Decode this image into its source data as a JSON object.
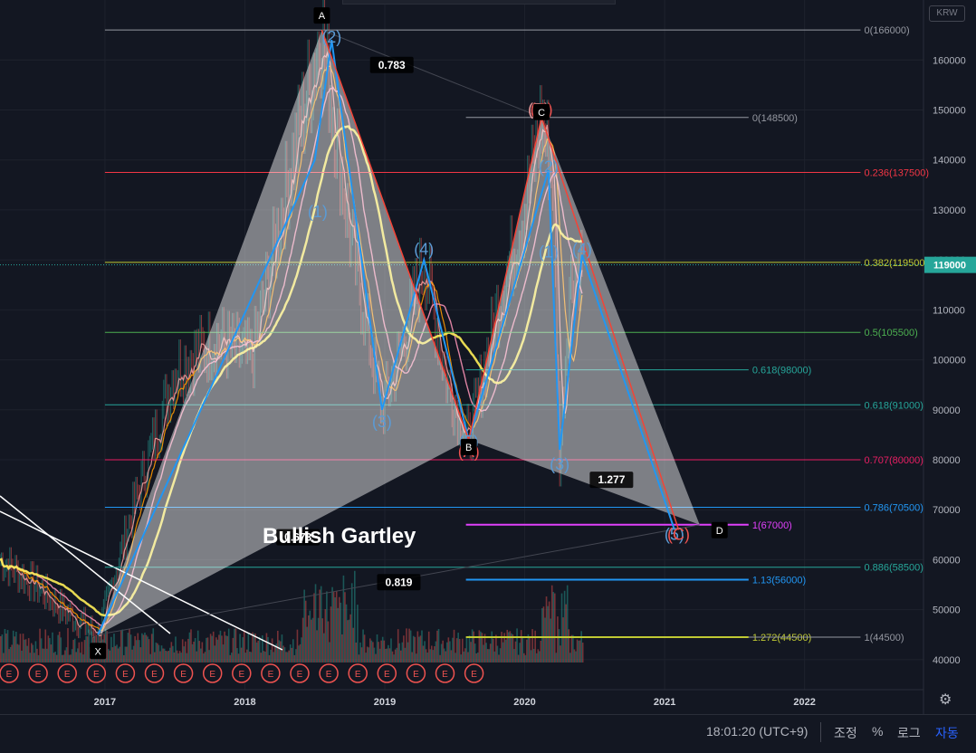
{
  "header": {
    "currency": "KRW"
  },
  "footer": {
    "time": "18:01:20 (UTC+9)",
    "adjust": "조정",
    "percent": "%",
    "log": "로그",
    "auto": "자동"
  },
  "chart_data": {
    "type": "line",
    "title": "Bullish Gartley",
    "price_axis": {
      "min": 34000,
      "max": 172000,
      "ticks": [
        40000,
        50000,
        60000,
        70000,
        80000,
        90000,
        100000,
        110000,
        120000,
        130000,
        140000,
        150000,
        160000
      ]
    },
    "time_axis": {
      "start": 2016.25,
      "end": 2022.85,
      "ticks": [
        {
          "label": "2017",
          "t": 2017.0
        },
        {
          "label": "2018",
          "t": 2018.0
        },
        {
          "label": "2019",
          "t": 2019.0
        },
        {
          "label": "2020",
          "t": 2020.0
        },
        {
          "label": "2021",
          "t": 2021.0
        },
        {
          "label": "2022",
          "t": 2022.0
        }
      ]
    },
    "current_price": {
      "value": 119000,
      "label": "119000"
    },
    "fib_levels": [
      {
        "label": "0(166000)",
        "price": 166000,
        "x1": 2017.0,
        "x2": 2022.4,
        "color": "#9598a1"
      },
      {
        "label": "0(148500)",
        "price": 148500,
        "x1": 2019.58,
        "x2": 2021.6,
        "color": "#9598a1"
      },
      {
        "label": "0.236(137500)",
        "price": 137500,
        "x1": 2017.0,
        "x2": 2022.4,
        "color": "#f23645"
      },
      {
        "label": "0.382(119500)",
        "price": 119500,
        "x1": 2017.0,
        "x2": 2022.4,
        "color": "#c0ca33"
      },
      {
        "label": "0.5(105500)",
        "price": 105500,
        "x1": 2017.0,
        "x2": 2022.4,
        "color": "#4caf50"
      },
      {
        "label": "0.618(98000)",
        "price": 98000,
        "x1": 2019.58,
        "x2": 2021.6,
        "color": "#26a69a"
      },
      {
        "label": "0.618(91000)",
        "price": 91000,
        "x1": 2017.0,
        "x2": 2022.4,
        "color": "#26a69a"
      },
      {
        "label": "0.707(80000)",
        "price": 80000,
        "x1": 2017.0,
        "x2": 2022.4,
        "color": "#e91e63"
      },
      {
        "label": "0.786(70500)",
        "price": 70500,
        "x1": 2017.0,
        "x2": 2022.4,
        "color": "#2196f3"
      },
      {
        "label": "1(67000)",
        "price": 67000,
        "x1": 2019.58,
        "x2": 2021.6,
        "color": "#e040fb"
      },
      {
        "label": "0.886(58500)",
        "price": 58500,
        "x1": 2017.0,
        "x2": 2022.4,
        "color": "#26a69a"
      },
      {
        "label": "1.13(56000)",
        "price": 56000,
        "x1": 2019.58,
        "x2": 2021.6,
        "color": "#2196f3"
      },
      {
        "label": "1.272(44500)",
        "price": 44500,
        "x1": 2019.58,
        "x2": 2021.6,
        "color": "#c0ca33"
      },
      {
        "label": "1(44500)",
        "price": 44500,
        "x1": 2021.6,
        "x2": 2022.4,
        "color": "#9598a1"
      }
    ],
    "gartley": {
      "points": [
        {
          "label": "X",
          "t": 2016.95,
          "price": 45000
        },
        {
          "label": "A",
          "t": 2018.55,
          "price": 166000
        },
        {
          "label": "B",
          "t": 2019.6,
          "price": 84000
        },
        {
          "label": "C",
          "t": 2020.12,
          "price": 148500
        },
        {
          "label": "D",
          "t": 2021.25,
          "price": 67000
        }
      ],
      "ratios": [
        {
          "label": "0.783",
          "t": 2019.05,
          "price": 159000
        },
        {
          "label": "1.277",
          "t": 2020.62,
          "price": 76000
        },
        {
          "label": "0.673",
          "t": 2018.38,
          "price": 64500
        },
        {
          "label": "0.819",
          "t": 2019.1,
          "price": 55500
        }
      ]
    },
    "waves": [
      {
        "label": "(2)",
        "t": 2018.62,
        "price": 163500,
        "color": "#5b9bd5"
      },
      {
        "label": "(1)",
        "t": 2018.52,
        "price": 128500,
        "color": "#5b9bd5"
      },
      {
        "label": "(4)",
        "t": 2019.28,
        "price": 121000,
        "color": "#5b9bd5"
      },
      {
        "label": "(3)",
        "t": 2018.98,
        "price": 86500,
        "color": "#5b9bd5"
      },
      {
        "label": "(5)",
        "t": 2019.6,
        "price": 82500,
        "color": "#5b9bd5"
      },
      {
        "label": "(A)",
        "t": 2019.6,
        "price": 80500,
        "color": "#ef5350"
      },
      {
        "label": "(C)",
        "t": 2020.12,
        "price": 149000,
        "color": "#ef5350"
      },
      {
        "label": "(B)",
        "t": 2020.1,
        "price": 149000,
        "color": "#ef9a9a"
      },
      {
        "label": "(2)",
        "t": 2020.17,
        "price": 137500,
        "color": "#5b9bd5"
      },
      {
        "label": "(1)",
        "t": 2020.17,
        "price": 120500,
        "color": "#5b9bd5"
      },
      {
        "label": "(4)",
        "t": 2020.41,
        "price": 121000,
        "color": "#5b9bd5"
      },
      {
        "label": "(3)",
        "t": 2020.25,
        "price": 78000,
        "color": "#5b9bd5"
      },
      {
        "label": "(5)",
        "t": 2021.07,
        "price": 64000,
        "color": "#5b9bd5"
      },
      {
        "label": "(C)",
        "t": 2021.1,
        "price": 64000,
        "color": "#ef5350"
      }
    ],
    "earnings_marker": "E"
  }
}
